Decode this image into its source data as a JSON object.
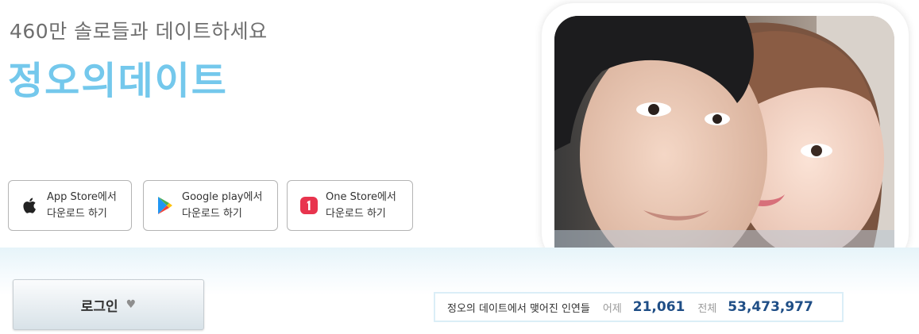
{
  "hero": {
    "tagline": "460만 솔로들과 데이트하세요",
    "brand": "정오의데이트",
    "stores": [
      {
        "icon": "apple-icon",
        "line1": "App Store에서",
        "line2": "다운로드 하기"
      },
      {
        "icon": "google-play-icon",
        "line1": "Google play에서",
        "line2": "다운로드 하기"
      },
      {
        "icon": "one-store-icon",
        "line1": "One Store에서",
        "line2": "다운로드 하기"
      }
    ]
  },
  "login": {
    "label": "로그인"
  },
  "stats": {
    "title": "정오의 데이트에서 맺어진 인연들",
    "yesterday_label": "어제",
    "yesterday_value": "21,061",
    "total_label": "전체",
    "total_value": "53,473,977"
  },
  "colors": {
    "brand": "#74c8ec",
    "stat_value": "#1f4e86"
  }
}
